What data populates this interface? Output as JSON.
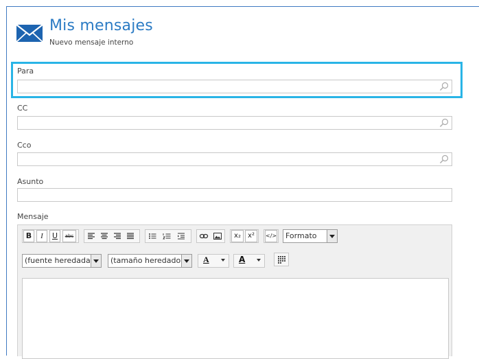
{
  "header": {
    "title": "Mis mensajes",
    "subtitle": "Nuevo mensaje interno",
    "icon": "envelope-icon",
    "accent_color": "#2b7bc4"
  },
  "form": {
    "para_label": "Para",
    "cc_label": "CC",
    "cco_label": "Cco",
    "asunto_label": "Asunto",
    "mensaje_label": "Mensaje",
    "para_value": "",
    "cc_value": "",
    "cco_value": "",
    "asunto_value": "",
    "highlight_color": "#29b4e6"
  },
  "editor": {
    "toolbar_row1": [
      "bold",
      "italic",
      "underline",
      "strikethrough",
      "align-left",
      "align-center",
      "align-right",
      "justify",
      "bullet-list",
      "numbered-list",
      "indent",
      "link",
      "image",
      "subscript",
      "superscript",
      "source"
    ],
    "bold_label": "B",
    "italic_label": "I",
    "underline_label": "U",
    "strike_label": "abc",
    "subscript_label": "x₂",
    "superscript_label": "x²",
    "source_label": "</>",
    "format_select": "Formato",
    "font_select": "(fuente heredada)",
    "size_select": "(tamaño heredado)",
    "text_color_label": "A",
    "bg_color_label": "A"
  }
}
